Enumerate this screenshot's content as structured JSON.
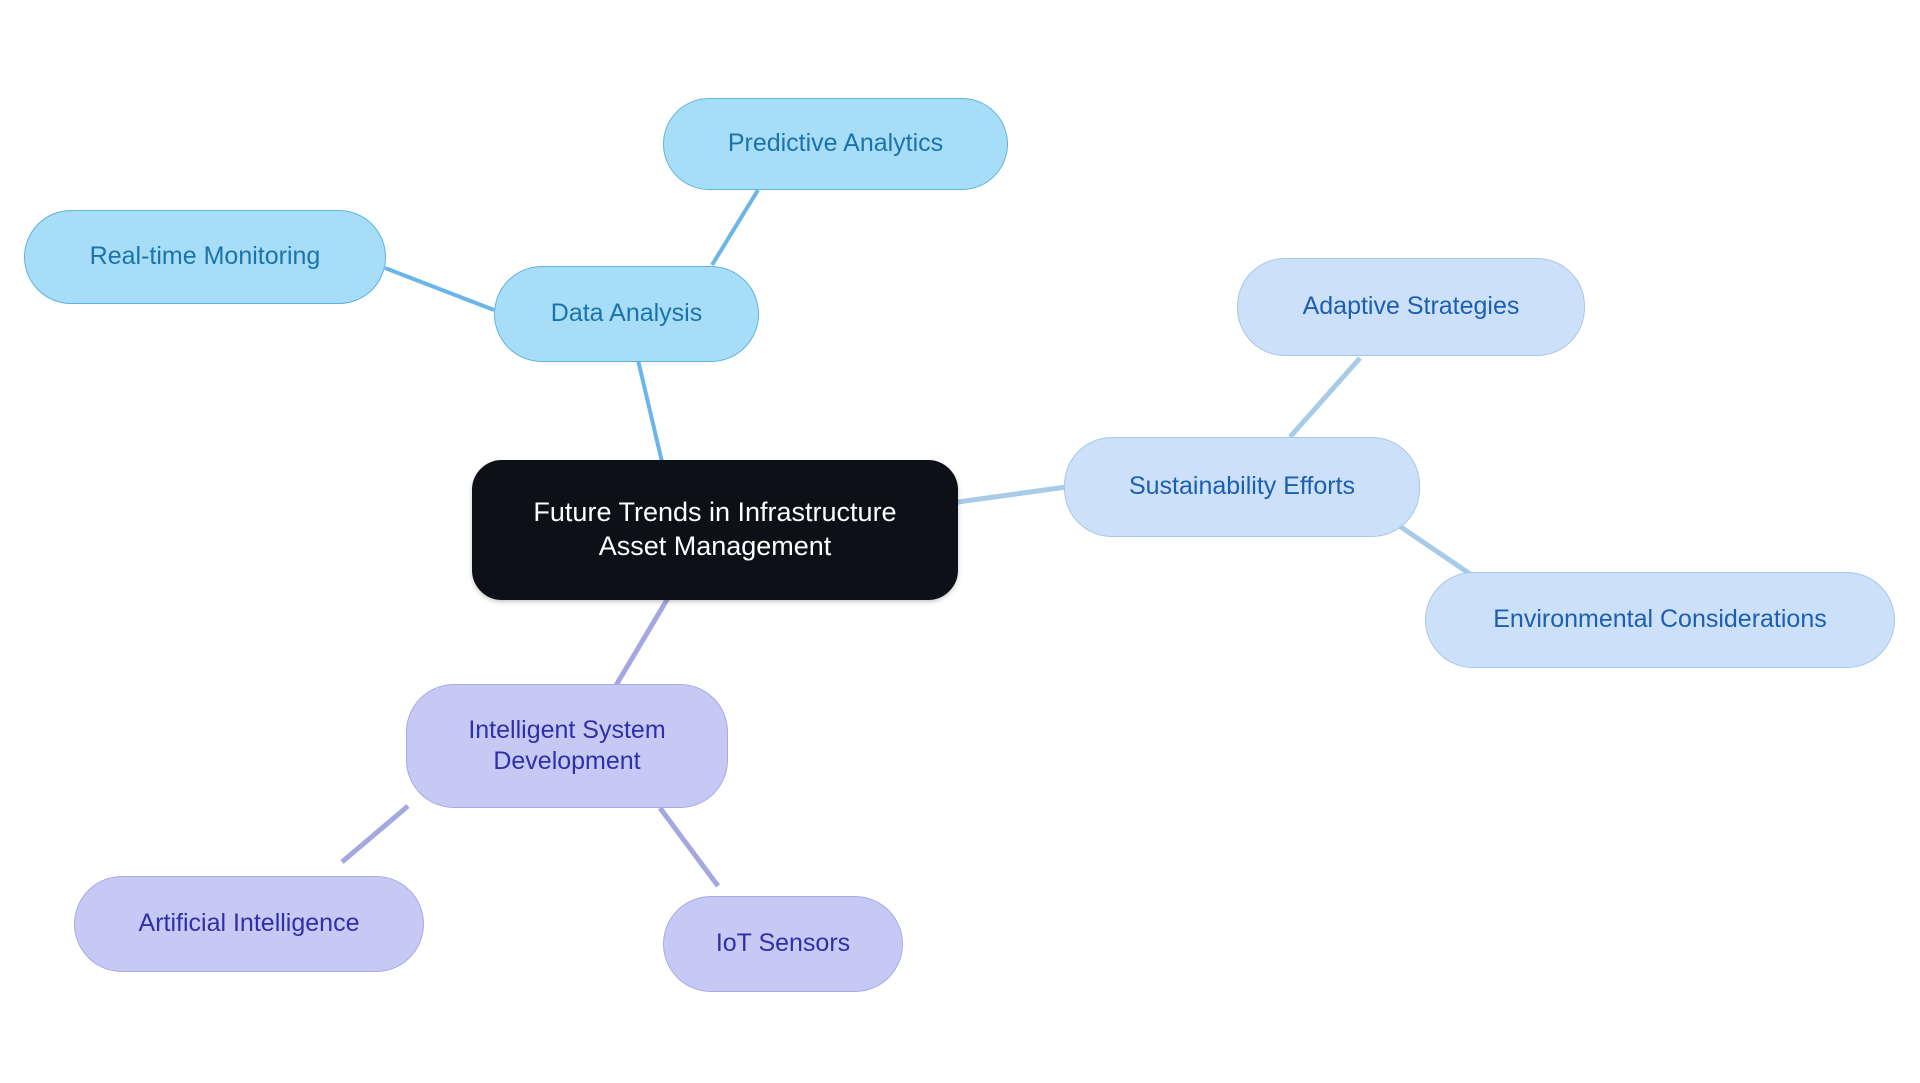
{
  "diagram": {
    "type": "mindmap",
    "background_color": "#ffffff",
    "title": "Future Trends in Infrastructure Asset Management"
  },
  "palette": {
    "root_fill": "#0d1117",
    "root_text": "#ffffff",
    "blue_strong_fill": "#a8ddf7",
    "blue_strong_border": "#5fb3e0",
    "blue_strong_text": "#1a74ab",
    "blue_strong_edge": "#6bb5e8",
    "blue_pale_fill": "#cce0f9",
    "blue_pale_border": "#a7c7ea",
    "blue_pale_text": "#1c5fb0",
    "blue_pale_edge": "#a8cbe8",
    "purple_fill": "#c7c9f5",
    "purple_border": "#a7aae6",
    "purple_text": "#2f2fa8",
    "purple_edge": "#a5a8e0"
  },
  "nodes": {
    "root": {
      "label": "Future Trends in Infrastructure\nAsset Management"
    },
    "data_analysis": {
      "label": "Data Analysis"
    },
    "predictive_analytics": {
      "label": "Predictive Analytics"
    },
    "realtime_monitoring": {
      "label": "Real-time Monitoring"
    },
    "sustainability_efforts": {
      "label": "Sustainability Efforts"
    },
    "adaptive_strategies": {
      "label": "Adaptive Strategies"
    },
    "environmental_considerations": {
      "label": "Environmental Considerations"
    },
    "intelligent_system_development": {
      "label": "Intelligent System\nDevelopment"
    },
    "artificial_intelligence": {
      "label": "Artificial Intelligence"
    },
    "iot_sensors": {
      "label": "IoT Sensors"
    }
  },
  "edges": [
    {
      "from": "root",
      "to": "data_analysis",
      "color": "#6bb5e8"
    },
    {
      "from": "data_analysis",
      "to": "predictive_analytics",
      "color": "#6bb5e8"
    },
    {
      "from": "data_analysis",
      "to": "realtime_monitoring",
      "color": "#6bb5e8"
    },
    {
      "from": "root",
      "to": "sustainability_efforts",
      "color": "#a8cbe8"
    },
    {
      "from": "sustainability_efforts",
      "to": "adaptive_strategies",
      "color": "#a8cbe8"
    },
    {
      "from": "sustainability_efforts",
      "to": "environmental_considerations",
      "color": "#a8cbe8"
    },
    {
      "from": "root",
      "to": "intelligent_system_development",
      "color": "#a5a8e0"
    },
    {
      "from": "intelligent_system_development",
      "to": "artificial_intelligence",
      "color": "#a5a8e0"
    },
    {
      "from": "intelligent_system_development",
      "to": "iot_sensors",
      "color": "#a5a8e0"
    }
  ]
}
